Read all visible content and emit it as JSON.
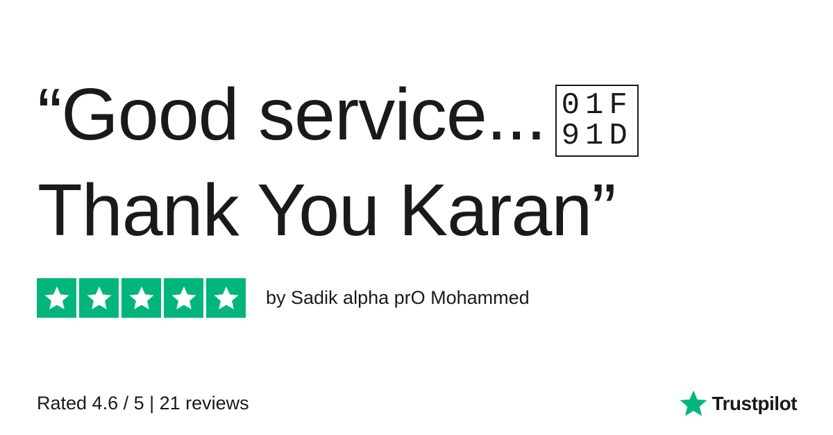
{
  "review": {
    "quote_line1": "“Good service...",
    "emoji_codepoint_top": "01F",
    "emoji_codepoint_bottom": "91D",
    "quote_line2": "Thank You Karan”",
    "star_count": 5,
    "author": "by Sadik alpha prO Mohammed"
  },
  "footer": {
    "rating_summary": "Rated 4.6 / 5 | 21 reviews"
  },
  "brand": {
    "name": "Trustpilot",
    "logo_icon": "star-icon",
    "color": "#00b67a"
  },
  "colors": {
    "star_tile": "#00b67a",
    "star_fill": "#ffffff",
    "text": "#1a1a1a",
    "background": "#ffffff"
  }
}
